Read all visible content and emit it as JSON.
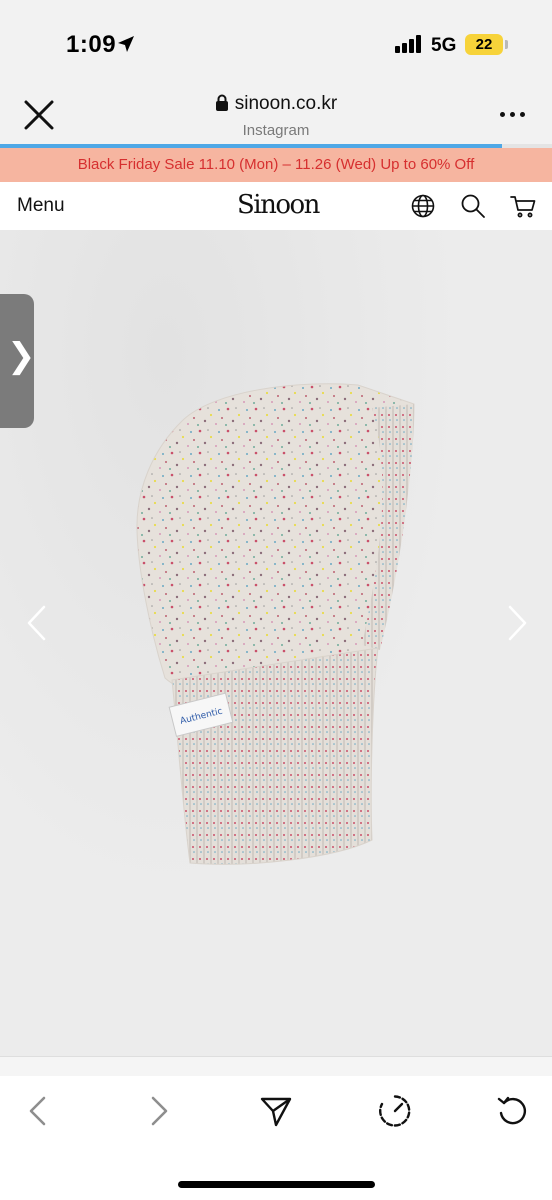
{
  "status_bar": {
    "time": "1:09",
    "network": "5G",
    "battery": "22",
    "icons": [
      "location-arrow-icon",
      "signal-bars-icon",
      "battery-icon"
    ],
    "battery_color": "#f7d33a"
  },
  "browser": {
    "url": "sinoon.co.kr",
    "source": "Instagram",
    "progress": 0.91,
    "icons": [
      "close-icon",
      "lock-icon",
      "more-icon"
    ],
    "accent": "#4fa8e6"
  },
  "site": {
    "promo": "Black Friday Sale 11.10 (Mon) – 11.26 (Wed) Up to 60% Off",
    "menu_label": "Menu",
    "logo": "Sinoon",
    "nav_icons": [
      "globe-icon",
      "search-icon",
      "cart-icon"
    ],
    "promo_bg": "#f6b5a0",
    "promo_text_color": "#d62f2f",
    "product": {
      "side_tab": "❯",
      "icons": [
        "prev-slide-icon",
        "next-slide-icon"
      ],
      "label_text": "Authentic"
    }
  },
  "toolbar": {
    "icons": [
      "back-icon",
      "forward-icon",
      "share-icon",
      "open-in-browser-icon",
      "reload-icon"
    ]
  }
}
